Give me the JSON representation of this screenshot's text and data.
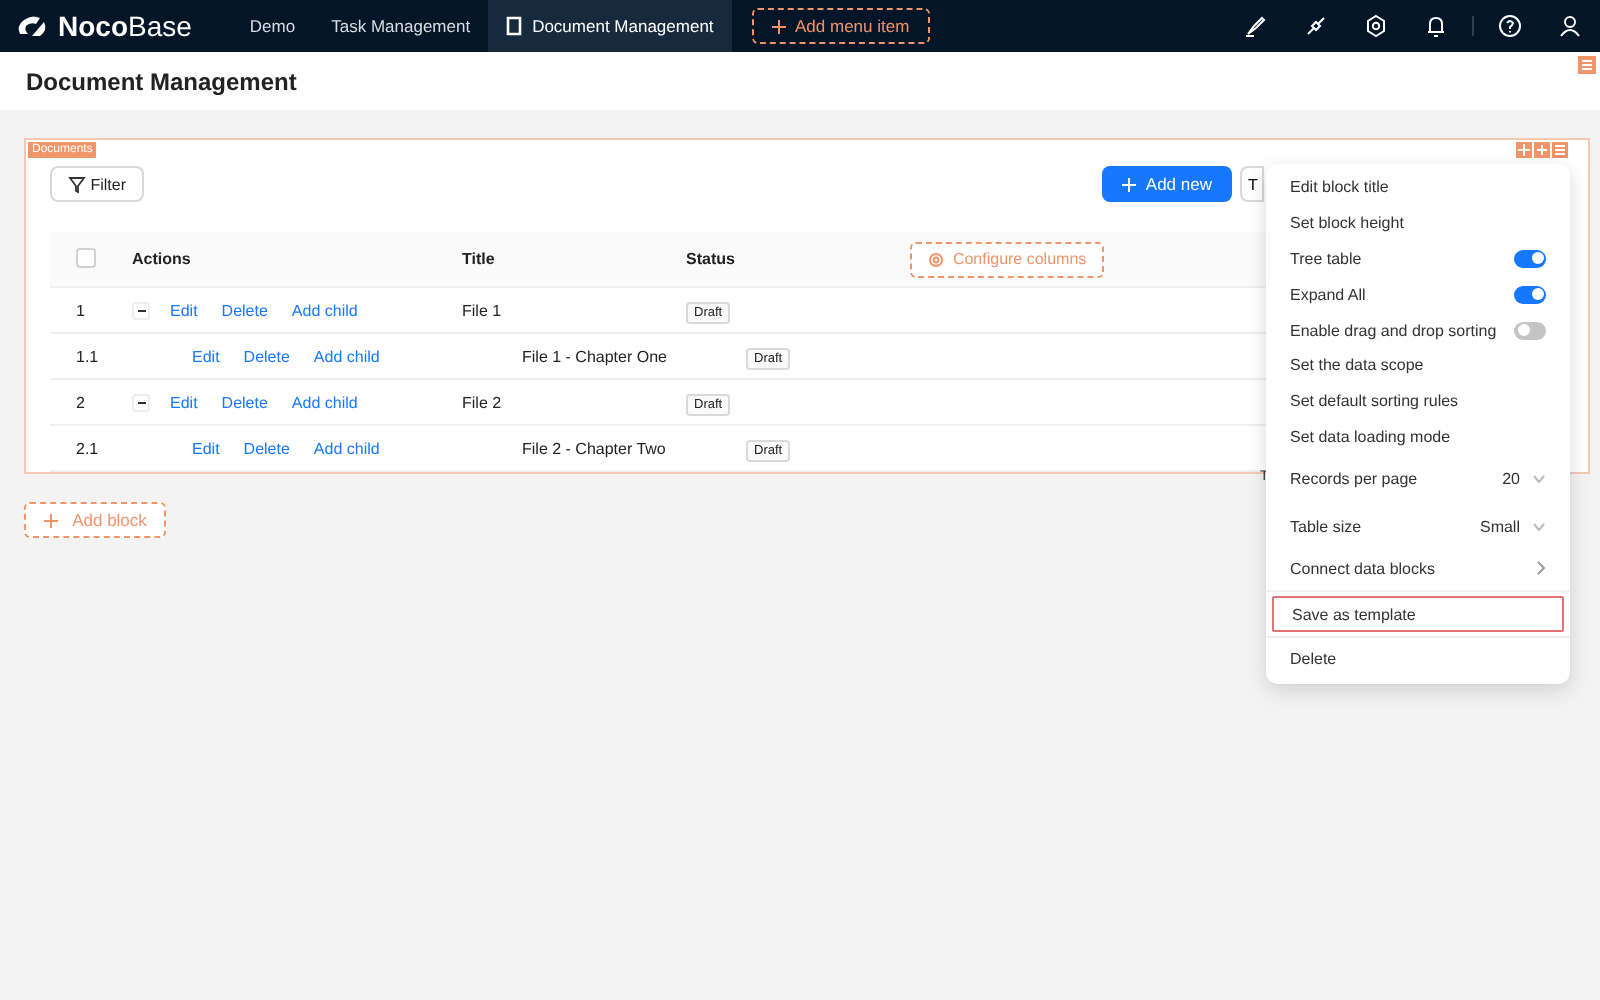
{
  "header": {
    "logo_bold": "Noco",
    "logo_light": "Base",
    "menu": [
      {
        "label": "Demo",
        "selected": false
      },
      {
        "label": "Task Management",
        "selected": false
      },
      {
        "label": "Document Management",
        "selected": true
      }
    ],
    "add_menu_item": "Add menu item"
  },
  "page_title": "Document Management",
  "block": {
    "tag": "Documents",
    "filter": "Filter",
    "add_new": "Add new",
    "cut_button": "T",
    "table": {
      "select_all_checked": false,
      "columns": [
        "Actions",
        "Title",
        "Status"
      ],
      "configure": "Configure columns",
      "rows": [
        {
          "index": "1",
          "expandable": true,
          "child": false,
          "actions": [
            "Edit",
            "Delete",
            "Add child"
          ],
          "title": "File 1",
          "status": "Draft"
        },
        {
          "index": "1.1",
          "expandable": false,
          "child": true,
          "actions": [
            "Edit",
            "Delete",
            "Add child"
          ],
          "title": "File 1 - Chapter One",
          "status": "Draft"
        },
        {
          "index": "2",
          "expandable": true,
          "child": false,
          "actions": [
            "Edit",
            "Delete",
            "Add child"
          ],
          "title": "File 2",
          "status": "Draft"
        },
        {
          "index": "2.1",
          "expandable": false,
          "child": true,
          "actions": [
            "Edit",
            "Delete",
            "Add child"
          ],
          "title": "File 2 - Chapter Two",
          "status": "Draft"
        }
      ]
    },
    "pagination_cut": "T"
  },
  "add_block": "Add block",
  "menu": {
    "groups": [
      [
        {
          "kind": "plain",
          "label": "Edit block title",
          "highlighted": false
        },
        {
          "kind": "plain",
          "label": "Set block height",
          "highlighted": false
        },
        {
          "kind": "switch",
          "label": "Tree table",
          "on": true,
          "highlighted": false
        },
        {
          "kind": "switch",
          "label": "Expand All",
          "on": true,
          "highlighted": false
        },
        {
          "kind": "switch",
          "label": "Enable drag and drop sorting",
          "on": false,
          "highlighted": false
        },
        {
          "kind": "plain",
          "label": "Set the data scope",
          "highlighted": false
        },
        {
          "kind": "plain",
          "label": "Set default sorting rules",
          "highlighted": false
        },
        {
          "kind": "plain",
          "label": "Set data loading mode",
          "highlighted": false
        },
        {
          "kind": "select",
          "label": "Records per page",
          "value": "20",
          "highlighted": false
        },
        {
          "kind": "select",
          "label": "Table size",
          "value": "Small",
          "highlighted": false
        },
        {
          "kind": "submenu",
          "label": "Connect data blocks",
          "highlighted": false
        }
      ],
      [
        {
          "kind": "plain",
          "label": "Save as template",
          "highlighted": true
        }
      ],
      [
        {
          "kind": "plain",
          "label": "Delete",
          "highlighted": false
        }
      ]
    ]
  }
}
